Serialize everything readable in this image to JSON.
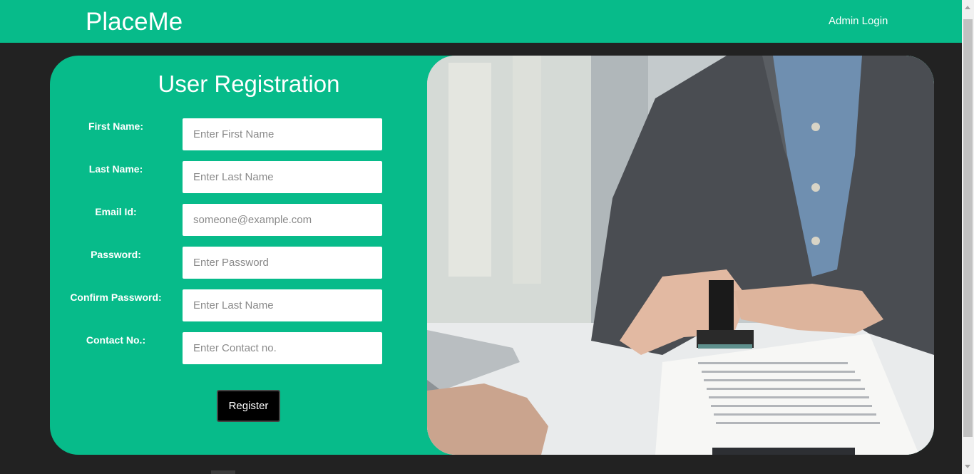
{
  "brand": "PlaceMe",
  "nav": {
    "admin_login": "Admin Login"
  },
  "form": {
    "title": "User Registration",
    "fields": [
      {
        "label": "First Name:",
        "placeholder": "Enter First Name"
      },
      {
        "label": "Last Name:",
        "placeholder": "Enter Last Name"
      },
      {
        "label": "Email Id:",
        "placeholder": "someone@example.com"
      },
      {
        "label": "Password:",
        "placeholder": "Enter Password"
      },
      {
        "label": "Confirm Password:",
        "placeholder": "Enter Last Name"
      },
      {
        "label": "Contact No.:",
        "placeholder": "Enter Contact no."
      }
    ],
    "submit_label": "Register"
  },
  "photo": {
    "subject": "business-person-stamping-document"
  },
  "colors": {
    "accent": "#07bb8a",
    "background": "#222222",
    "button": "#000000"
  }
}
